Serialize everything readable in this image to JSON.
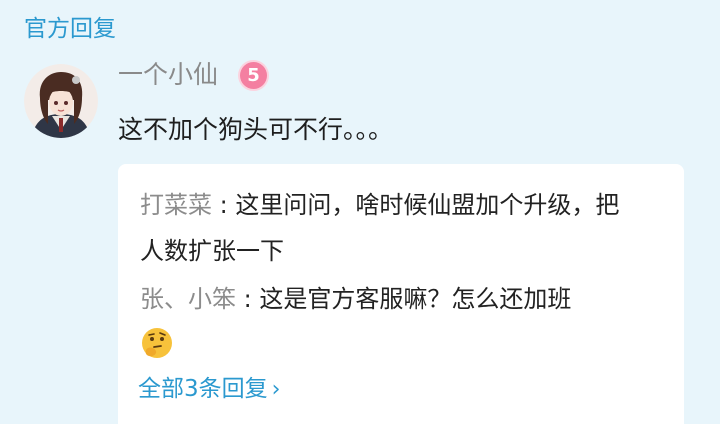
{
  "section_title": "官方回复",
  "comment": {
    "username": "一个小仙",
    "level": "5",
    "text": "这不加个狗头可不行。。。",
    "avatar_icon": "anime-girl-avatar"
  },
  "replies": [
    {
      "name": "打菜菜",
      "separator": " : ",
      "text": "这里问问，啥时候仙盟加个升级，把人数扩张一下"
    },
    {
      "name": "张、小笨",
      "separator": " : ",
      "text": "这是官方客服嘛？怎么还加班",
      "emoji": "thinking-face-icon"
    }
  ],
  "all_replies_link": "全部3条回复",
  "colors": {
    "background": "#e8f5fb",
    "accent": "#2b99cf",
    "level_badge": "#f47fa1",
    "name_gray": "#8c8c8c"
  }
}
